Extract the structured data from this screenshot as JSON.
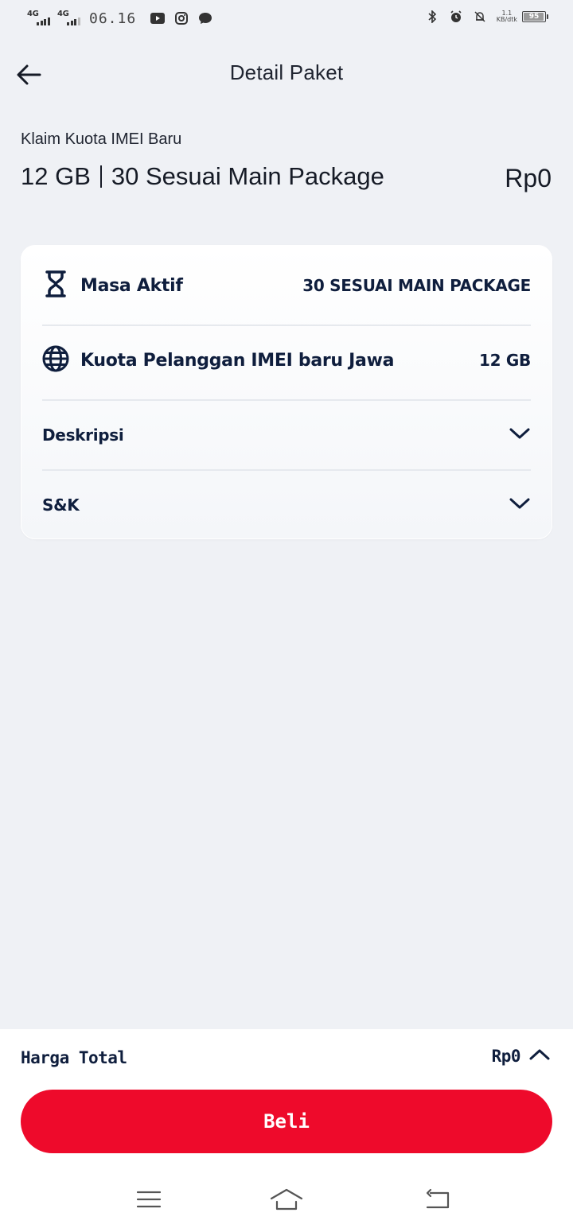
{
  "status_bar": {
    "network1": "4G",
    "network2": "4G",
    "time": "06.16",
    "speed_value": "1.1",
    "speed_unit": "KB/dtk",
    "battery": "95"
  },
  "header": {
    "title": "Detail Paket"
  },
  "package": {
    "subtitle": "Klaim Kuota IMEI Baru",
    "quota": "12 GB",
    "validity": "30 Sesuai Main Package",
    "price": "Rp0"
  },
  "details": {
    "rows": [
      {
        "icon": "hourglass-icon",
        "label": "Masa Aktif",
        "value": "30 SESUAI MAIN PACKAGE"
      },
      {
        "icon": "globe-icon",
        "label": "Kuota Pelanggan IMEI baru Jawa",
        "value": "12 GB"
      }
    ],
    "expandables": [
      {
        "label": "Deskripsi"
      },
      {
        "label": "S&K"
      }
    ]
  },
  "footer": {
    "total_label": "Harga Total",
    "total_price": "Rp0",
    "buy_label": "Beli"
  },
  "colors": {
    "accent": "#ee0a2b",
    "navy": "#0f1e3d",
    "background": "#eff1f5"
  }
}
